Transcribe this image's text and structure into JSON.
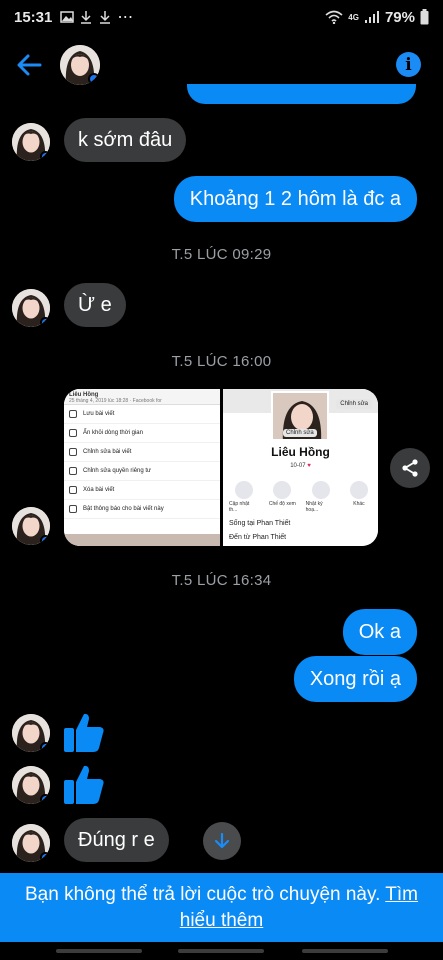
{
  "status_bar": {
    "time": "15:31",
    "network": "4G",
    "battery": "79%"
  },
  "header": {
    "contact_avatar": "contact-avatar",
    "back_icon": "arrow-left-icon",
    "info_icon": "info-icon"
  },
  "messages": {
    "m1": "k sớm đâu",
    "m2": "Khoảng 1 2 hôm là đc a",
    "stamp1": "T.5 LÚC 09:29",
    "m3": "Ừ e",
    "stamp2": "T.5 LÚC 16:00",
    "stamp3": "T.5 LÚC 16:34",
    "m4": "Ok a",
    "m5": "Xong rồi ạ",
    "m6": "Đúng r e"
  },
  "shared_image": {
    "left_header_name": "Liêu Hồng",
    "left_header_date": "25 tháng 4, 2019 lúc 18:28 · Facebook for",
    "menu": [
      {
        "label": "Lưu bài viết",
        "sub": "Thêm vào danh sách mục đã lưu"
      },
      {
        "label": "Ẩn khỏi dòng thời gian",
        "sub": "Bài viết này có thể vẫn xuất hiện ở các nơi khác."
      },
      {
        "label": "Chỉnh sửa bài viết",
        "sub": ""
      },
      {
        "label": "Chỉnh sửa quyền riêng tư",
        "sub": ""
      },
      {
        "label": "Xóa bài viết",
        "sub": ""
      },
      {
        "label": "Bật thông báo cho bài viết này",
        "sub": ""
      }
    ],
    "profile_name": "Liêu Hồng",
    "profile_sub": "10-07",
    "edit_cover": "Chỉnh sửa",
    "edit_photo": "Chỉnh sửa",
    "actions": [
      "Cập nhật th...",
      "Chế độ xem",
      "Nhật ký hoạ...",
      "Khác"
    ],
    "lives_in": "Sống tại Phan Thiết",
    "from": "Đến từ Phan Thiết"
  },
  "banner": {
    "text": "Bạn không thể trả lời cuộc trò chuyện này. ",
    "link": "Tìm hiểu thêm"
  },
  "colors": {
    "accent": "#0a8af5",
    "incoming_bubble": "#3a3b3c",
    "background": "#000000"
  }
}
